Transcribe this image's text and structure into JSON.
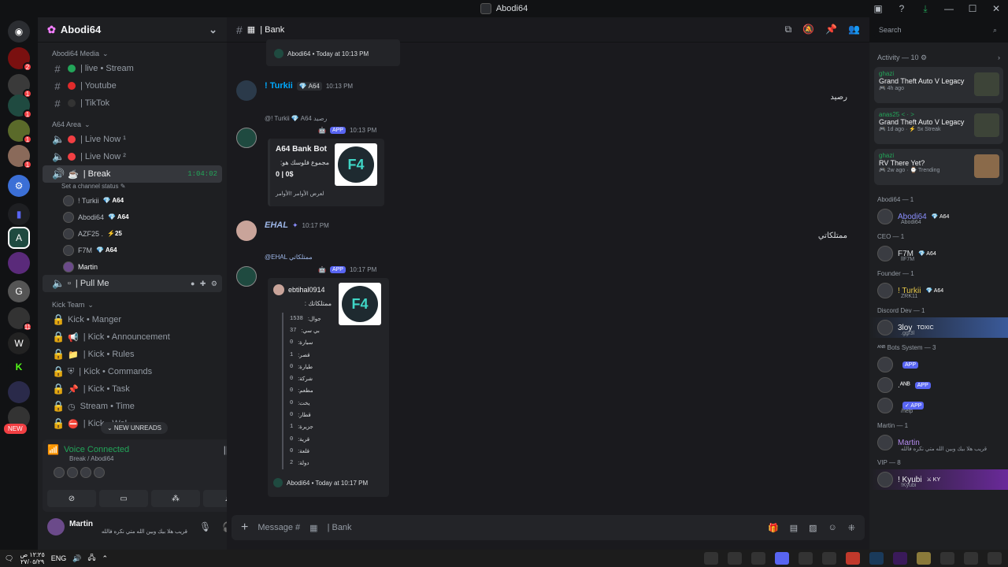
{
  "window": {
    "title": "Abodi64"
  },
  "server_list": [
    {
      "ping": "2"
    },
    {
      "ping": "1"
    },
    {
      "ping": "1"
    },
    {
      "ping": "1"
    },
    {
      "ping": "1"
    },
    {
      "ping": ""
    },
    {
      "ping": ""
    },
    {
      "ping": ""
    },
    {
      "ping": ""
    },
    {
      "ping": "11"
    },
    {
      "ping": ""
    },
    {
      "ping": ""
    },
    {
      "ping": ""
    },
    {
      "ping": ""
    }
  ],
  "server_new_badge": "NEW",
  "guild": {
    "name": "Abodi64"
  },
  "categories": {
    "media": "Abodi64 Media",
    "area": "A64 Area",
    "kick": "Kick Team"
  },
  "channels": {
    "live": "| live • Stream",
    "youtube": "| Youtube",
    "tiktok": "| TikTok",
    "live_now_1": "| Live Now ¹",
    "live_now_2": "| Live Now ²",
    "break": "| Break",
    "break_timer": "1:04:02",
    "break_status": "Set a channel status ✎",
    "pull_me": "| Pull Me",
    "kick_manger": "Kick • Manger",
    "kick_announcement": "| Kick • Announcement",
    "kick_rules": "| Kick • Rules",
    "kick_commands": "| Kick • Commands",
    "kick_task": "| Kick • Task",
    "stream_time": "Stream • Time",
    "kick_last": "| Kick • Wel"
  },
  "voice_users": [
    {
      "name": "! Turkii",
      "tag": "💎 A64"
    },
    {
      "name": "Abodi64",
      "tag": "💎 A64"
    },
    {
      "name": "AZF25 .",
      "tag": "⚡25"
    },
    {
      "name": "F7M",
      "tag": "💎 A64"
    },
    {
      "name": "Martin",
      "tag": ""
    }
  ],
  "new_unreads": "⌄ NEW UNREADS",
  "voice_panel": {
    "status": "Voice Connected",
    "location": "Break / Abodi64"
  },
  "user_panel": {
    "name": "Martin",
    "status": "قريب هلا بيك وبين الله متي نكره فالله"
  },
  "channel_header": {
    "name": "| Bank"
  },
  "search": {
    "placeholder": "Search"
  },
  "messages": {
    "top_footer": "Abodi64 • Today at 10:13 PM",
    "turkii_name": "! Turkii",
    "turkii_tag": "💎 A64",
    "turkii_time": "10:13 PM",
    "turkii_text": "رصيد",
    "reply1_ref": "@! Turkii 💎 A64  رصيد",
    "bot_time": "10:13 PM",
    "app_badge": "APP",
    "embed1_title": "A64 Bank Bot",
    "embed1_line1": "مجموع فلوسك هو:",
    "embed1_line2": "0 | 0$",
    "embed1_footer": "لعرض الأوامر !الأوامر",
    "ehal_name": "EHAL",
    "ehal_time": "10:17 PM",
    "ehal_text": "ممتلكاتي",
    "reply2_ref": "@EHAL ممتلكاتي",
    "bot2_time": "10:17 PM",
    "embed2_author": "ebtihal0914",
    "embed2_title": "ممتلكاتك :",
    "embed2_rows": [
      {
        "label": "جوال:",
        "value": "1538"
      },
      {
        "label": "بي سي:",
        "value": "37"
      },
      {
        "label": "سيارة:",
        "value": "0"
      },
      {
        "label": "قصر:",
        "value": "1"
      },
      {
        "label": "طيارة:",
        "value": "0"
      },
      {
        "label": "شركة:",
        "value": "0"
      },
      {
        "label": "مطعم:",
        "value": "0"
      },
      {
        "label": "يخت:",
        "value": "0"
      },
      {
        "label": "قطار:",
        "value": "0"
      },
      {
        "label": "جزيرة:",
        "value": "1"
      },
      {
        "label": "قرية:",
        "value": "0"
      },
      {
        "label": "قلعة:",
        "value": "0"
      },
      {
        "label": "دولة:",
        "value": "2"
      }
    ],
    "embed2_footer": "Abodi64 • Today at 10:17 PM"
  },
  "composer": {
    "placeholder": "Message #",
    "channel": "| Bank"
  },
  "members": {
    "activity_head": "Activity — 10 ⚙",
    "activities": [
      {
        "who": "ghazi",
        "game": "Grand Theft Auto V Legacy",
        "meta": "🎮 4h ago"
      },
      {
        "who": "anas25 < · >",
        "game": "Grand Theft Auto V Legacy",
        "meta": "🎮 1d ago · ⚡ 5x Streak"
      },
      {
        "who": "ghazi",
        "game": "RV There Yet?",
        "meta": "🎮 2w ago · ⌚ Trending"
      }
    ],
    "groups": [
      {
        "role": "Abodi64 — 1",
        "name": "Abodi64",
        "tag": "💎 A64",
        "sub": "Abodi64",
        "color": "#8b8fff"
      },
      {
        "role": "CEO — 1",
        "name": "F7M",
        "tag": "💎 A64",
        "sub": "llF7M",
        "color": "#dbdee1"
      },
      {
        "role": "Founder — 1",
        "name": "! Turkii",
        "tag": "💎 A64",
        "sub": "ZRK11",
        "color": "#e6c84a"
      },
      {
        "role": "Discord Dev — 1",
        "name": "3loy",
        "tag": "TOXIC",
        "sub": ".gg/3l",
        "color": "#f2f3f5"
      },
      {
        "role": "ᴬᴺᴮ Bots System — 3",
        "name": "",
        "tag": "APP",
        "sub": "",
        "color": "#f2f3f5"
      },
      {
        "role": "",
        "name": ".ᴬᴺᴮ",
        "tag": "APP",
        "sub": "",
        "color": "#f2f3f5"
      },
      {
        "role": "",
        "name": "",
        "tag": "✓ APP",
        "sub": "/help",
        "color": "#f2f3f5"
      },
      {
        "role": "Martin — 1",
        "name": "Martin",
        "tag": "",
        "sub": "قريب هلا بيك وبين الله متي نكره فالله",
        "color": "#b58cf0"
      },
      {
        "role": "VIP — 8",
        "name": "! Kyubi",
        "tag": "⚔ KY",
        "sub": "!Kyubi",
        "color": "#f2f3f5"
      }
    ]
  },
  "taskbar": {
    "time": "١٢:٢٥ ص",
    "date": "٢٧/٠٥/٢٩",
    "lang": "ENG"
  }
}
